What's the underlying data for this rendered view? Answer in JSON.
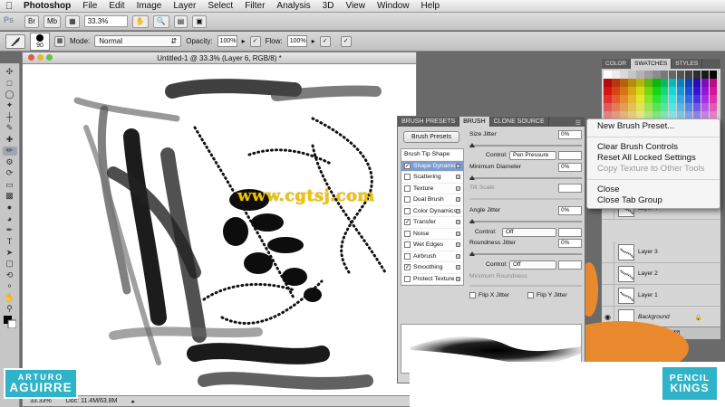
{
  "menubar": {
    "apple": "",
    "items": [
      "Photoshop",
      "File",
      "Edit",
      "Image",
      "Layer",
      "Select",
      "Filter",
      "Analysis",
      "3D",
      "View",
      "Window",
      "Help"
    ]
  },
  "appbar": {
    "logo": "Ps",
    "bridge": "Br",
    "minibridge": "Mb",
    "zoom": "33.3%"
  },
  "options": {
    "brush_size": "90",
    "mode_label": "Mode:",
    "mode_value": "Normal",
    "opacity_label": "Opacity:",
    "opacity_value": "100%",
    "flow_label": "Flow:",
    "flow_value": "100%"
  },
  "document": {
    "title": "Untitled-1 @ 33.3% (Layer 6, RGB/8) *",
    "zoom": "33.33%",
    "doc_info": "Doc: 11.4M/63.8M"
  },
  "brush_panel": {
    "tabs": [
      "BRUSH PRESETS",
      "BRUSH",
      "CLONE SOURCE"
    ],
    "active_tab": 1,
    "presets_button": "Brush Presets",
    "options": [
      {
        "label": "Brush Tip Shape",
        "checkbox": false,
        "checked": false,
        "lock": false
      },
      {
        "label": "Shape Dynamics",
        "checkbox": true,
        "checked": true,
        "lock": true,
        "selected": true
      },
      {
        "label": "Scattering",
        "checkbox": true,
        "checked": false,
        "lock": true
      },
      {
        "label": "Texture",
        "checkbox": true,
        "checked": false,
        "lock": true
      },
      {
        "label": "Dual Brush",
        "checkbox": true,
        "checked": false,
        "lock": true
      },
      {
        "label": "Color Dynamics",
        "checkbox": true,
        "checked": false,
        "lock": true
      },
      {
        "label": "Transfer",
        "checkbox": true,
        "checked": true,
        "lock": true
      },
      {
        "label": "Noise",
        "checkbox": true,
        "checked": false,
        "lock": true
      },
      {
        "label": "Wet Edges",
        "checkbox": true,
        "checked": false,
        "lock": true
      },
      {
        "label": "Airbrush",
        "checkbox": true,
        "checked": false,
        "lock": true
      },
      {
        "label": "Smoothing",
        "checkbox": true,
        "checked": true,
        "lock": true
      },
      {
        "label": "Protect Texture",
        "checkbox": true,
        "checked": false,
        "lock": true
      }
    ],
    "size_jitter_label": "Size Jitter",
    "size_jitter_value": "0%",
    "control_label": "Control:",
    "size_control": "Pen Pressure",
    "min_diameter_label": "Minimum Diameter",
    "min_diameter_value": "0%",
    "tilt_scale_label": "Tilt Scale",
    "angle_jitter_label": "Angle Jitter",
    "angle_jitter_value": "0%",
    "angle_control": "Off",
    "roundness_jitter_label": "Roundness Jitter",
    "roundness_jitter_value": "0%",
    "roundness_control": "Off",
    "min_roundness_label": "Minimum Roundness",
    "flip_x": "Flip X Jitter",
    "flip_y": "Flip Y Jitter"
  },
  "swatches_panel": {
    "tabs": [
      "COLOR",
      "SWATCHES",
      "STYLES"
    ],
    "active_tab": 1
  },
  "context_menu": {
    "group1": [
      "New Brush Preset..."
    ],
    "group2": [
      "Clear Brush Controls",
      "Reset All Locked Settings",
      "Copy Texture to Other Tools"
    ],
    "group2_disabled": [
      false,
      false,
      true
    ],
    "group3": [
      "Close",
      "Close Tab Group"
    ]
  },
  "layers_panel": {
    "layers": [
      "Layer 4",
      "Layer 3",
      "Layer 2",
      "Layer 1",
      "Background"
    ],
    "footer_icons": [
      "link-icon",
      "fx-icon",
      "mask-icon",
      "adjustment-icon",
      "folder-icon",
      "new-layer-icon",
      "trash-icon"
    ]
  },
  "watermark": "www.cgtsj.com",
  "logos": {
    "left_top": "ARTURO",
    "left_bottom": "AGUIRRE",
    "right_top": "PENCIL",
    "right_bottom": "KINGS"
  },
  "colors": {
    "logo_teal": "#2fb3c8",
    "watermark_yellow": "#f0c400",
    "orange_accent": "#e8892e",
    "selection_blue": "#7d9dd0"
  }
}
